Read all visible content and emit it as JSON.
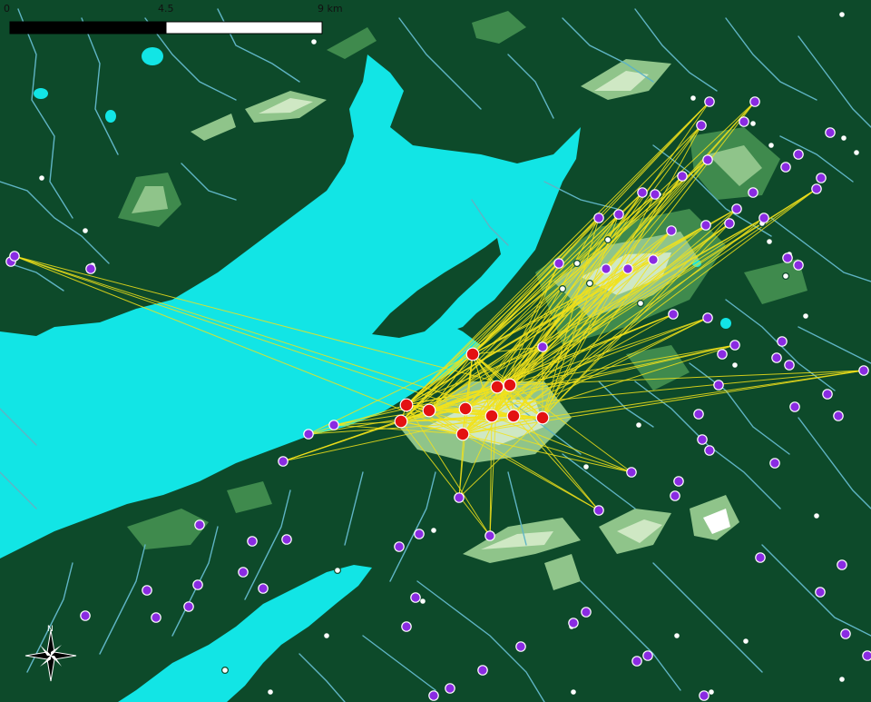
{
  "map": {
    "colors": {
      "land": "#0d4a2a",
      "water": "#12e5e5",
      "rivers": "#5fb4c4",
      "highland_light": "#cfe8c4",
      "highland_mid": "#8fc48a",
      "highland_dark": "#3f8a4d",
      "links": "#f2e21a",
      "source_sites": "#e31212",
      "target_sites": "#8a2be2",
      "other_sites": "#ffffff"
    },
    "scale_bar": {
      "labels": [
        "0",
        "4.5",
        "9 km"
      ],
      "segments": [
        {
          "fill": "#000000"
        },
        {
          "fill": "#ffffff"
        }
      ]
    },
    "north_arrow": {
      "label": "N",
      "icon": "compass-rose-icon"
    },
    "legend_visible": false
  }
}
